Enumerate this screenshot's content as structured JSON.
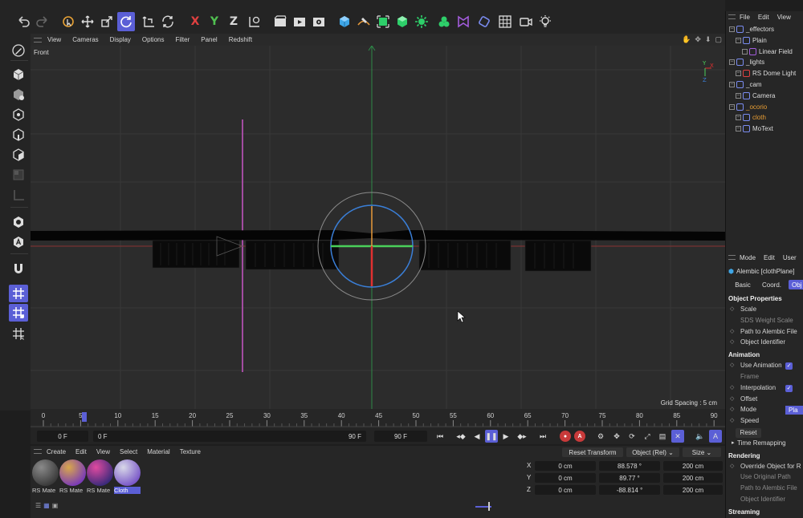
{
  "toolbar": {
    "axis_x": "X",
    "axis_y": "Y",
    "axis_z": "Z"
  },
  "viewport_menu": {
    "items": [
      "View",
      "Cameras",
      "Display",
      "Options",
      "Filter",
      "Panel",
      "Redshift"
    ]
  },
  "viewport": {
    "label": "Front",
    "grid_spacing": "Grid Spacing : 5 cm",
    "axis_y_label": "Y",
    "axis_x_label": "X",
    "axis_z_label": "Z"
  },
  "timeline": {
    "ticks": [
      "0",
      "5",
      "10",
      "15",
      "20",
      "25",
      "30",
      "35",
      "40",
      "45",
      "50",
      "55",
      "60",
      "65",
      "70",
      "75",
      "80",
      "85",
      "90"
    ],
    "current_frame": 5
  },
  "transport": {
    "current": "0 F",
    "range_start": "0 F",
    "range_end": "90 F",
    "end": "90 F"
  },
  "material_menu": {
    "items": [
      "Create",
      "Edit",
      "View",
      "Select",
      "Material",
      "Texture"
    ]
  },
  "materials": [
    {
      "label": "RS Mate",
      "color_a": "#8a8a8a",
      "color_b": "#3a3a3a"
    },
    {
      "label": "RS Mate",
      "color_a": "#d9a84a",
      "color_b": "#7a3ab8"
    },
    {
      "label": "RS Mate",
      "color_a": "#e04aa0",
      "color_b": "#3a2a7a"
    },
    {
      "label": "Cloth",
      "color_a": "#d8d8e8",
      "color_b": "#7a58c8"
    }
  ],
  "coordinates": {
    "reset_label": "Reset Transform",
    "mode_select": "Object (Rel)",
    "size_select": "Size",
    "rows": [
      {
        "axis": "X",
        "pos": "0 cm",
        "rot": "88.578 °",
        "size": "200 cm"
      },
      {
        "axis": "Y",
        "pos": "0 cm",
        "rot": "89.77 °",
        "size": "200 cm"
      },
      {
        "axis": "Z",
        "pos": "0 cm",
        "rot": "-88.814 °",
        "size": "200 cm"
      }
    ]
  },
  "object_manager": {
    "menu": [
      "File",
      "Edit",
      "View"
    ],
    "items": [
      {
        "label": "_effectors",
        "indent": 0,
        "color": "normal"
      },
      {
        "label": "Plain",
        "indent": 1,
        "color": "normal"
      },
      {
        "label": "Linear Field",
        "indent": 2,
        "color": "normal"
      },
      {
        "label": "_lights",
        "indent": 0,
        "color": "normal"
      },
      {
        "label": "RS Dome Light",
        "indent": 1,
        "color": "normal"
      },
      {
        "label": "_cam",
        "indent": 0,
        "color": "normal"
      },
      {
        "label": "Camera",
        "indent": 1,
        "color": "normal"
      },
      {
        "label": "_ocorio",
        "indent": 0,
        "color": "orange"
      },
      {
        "label": "cloth",
        "indent": 1,
        "color": "orange"
      },
      {
        "label": "MoText",
        "indent": 1,
        "color": "normal"
      }
    ]
  },
  "attributes": {
    "menu": [
      "Mode",
      "Edit",
      "User"
    ],
    "object_name": "Alembic [clothPlane]",
    "tabs": [
      "Basic",
      "Coord.",
      "Obj"
    ],
    "rows": [
      {
        "label": "Object Properties",
        "type": "header"
      },
      {
        "label": "Scale",
        "type": "normal"
      },
      {
        "label": "SDS Weight Scale",
        "type": "dim"
      },
      {
        "label": "Path to Alembic File",
        "type": "normal"
      },
      {
        "label": "Object Identifier",
        "type": "normal"
      },
      {
        "label": "Animation",
        "type": "header"
      },
      {
        "label": "Use Animation",
        "type": "check"
      },
      {
        "label": "Frame",
        "type": "dim"
      },
      {
        "label": "Interpolation",
        "type": "check"
      },
      {
        "label": "Offset",
        "type": "normal"
      },
      {
        "label": "Mode",
        "type": "mode"
      },
      {
        "label": "Speed",
        "type": "normal"
      },
      {
        "label": "Reset",
        "type": "button"
      },
      {
        "label": "Time Remapping",
        "type": "fold"
      },
      {
        "label": "Rendering",
        "type": "header"
      },
      {
        "label": "Override Object for R",
        "type": "normal"
      },
      {
        "label": "Use Original Path",
        "type": "dim"
      },
      {
        "label": "Path to Alembic File",
        "type": "dim"
      },
      {
        "label": "Object Identifier",
        "type": "dim"
      },
      {
        "label": "Streaming",
        "type": "header"
      }
    ],
    "mode_value": "Pla"
  }
}
